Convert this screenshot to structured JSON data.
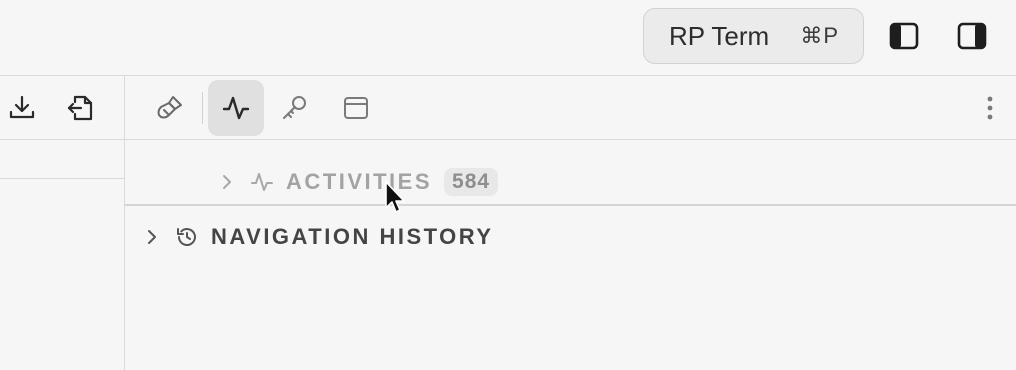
{
  "titlebar": {
    "command_button": {
      "label": "RP Term",
      "shortcut": "⌘P"
    },
    "icons": [
      "toggle-left-sidebar-icon",
      "toggle-right-sidebar-icon"
    ]
  },
  "left_toolbar": {
    "icons": [
      "download-icon",
      "import-file-icon"
    ]
  },
  "main_toolbar": {
    "tools": [
      {
        "icon": "brush-icon",
        "active": false
      },
      {
        "icon": "activity-icon",
        "active": true
      },
      {
        "icon": "key-icon",
        "active": false
      },
      {
        "icon": "window-icon",
        "active": false
      }
    ],
    "more_icon": "more-vertical-icon"
  },
  "sections": {
    "activities": {
      "label": "ACTIVITIES",
      "count": "584"
    },
    "navigation_history": {
      "label": "NAVIGATION HISTORY"
    }
  },
  "colors": {
    "background": "#f6f6f6",
    "border": "#dadada",
    "active_tool": "#e0e0e0",
    "muted_text": "#a3a3a3",
    "text": "#444444"
  }
}
